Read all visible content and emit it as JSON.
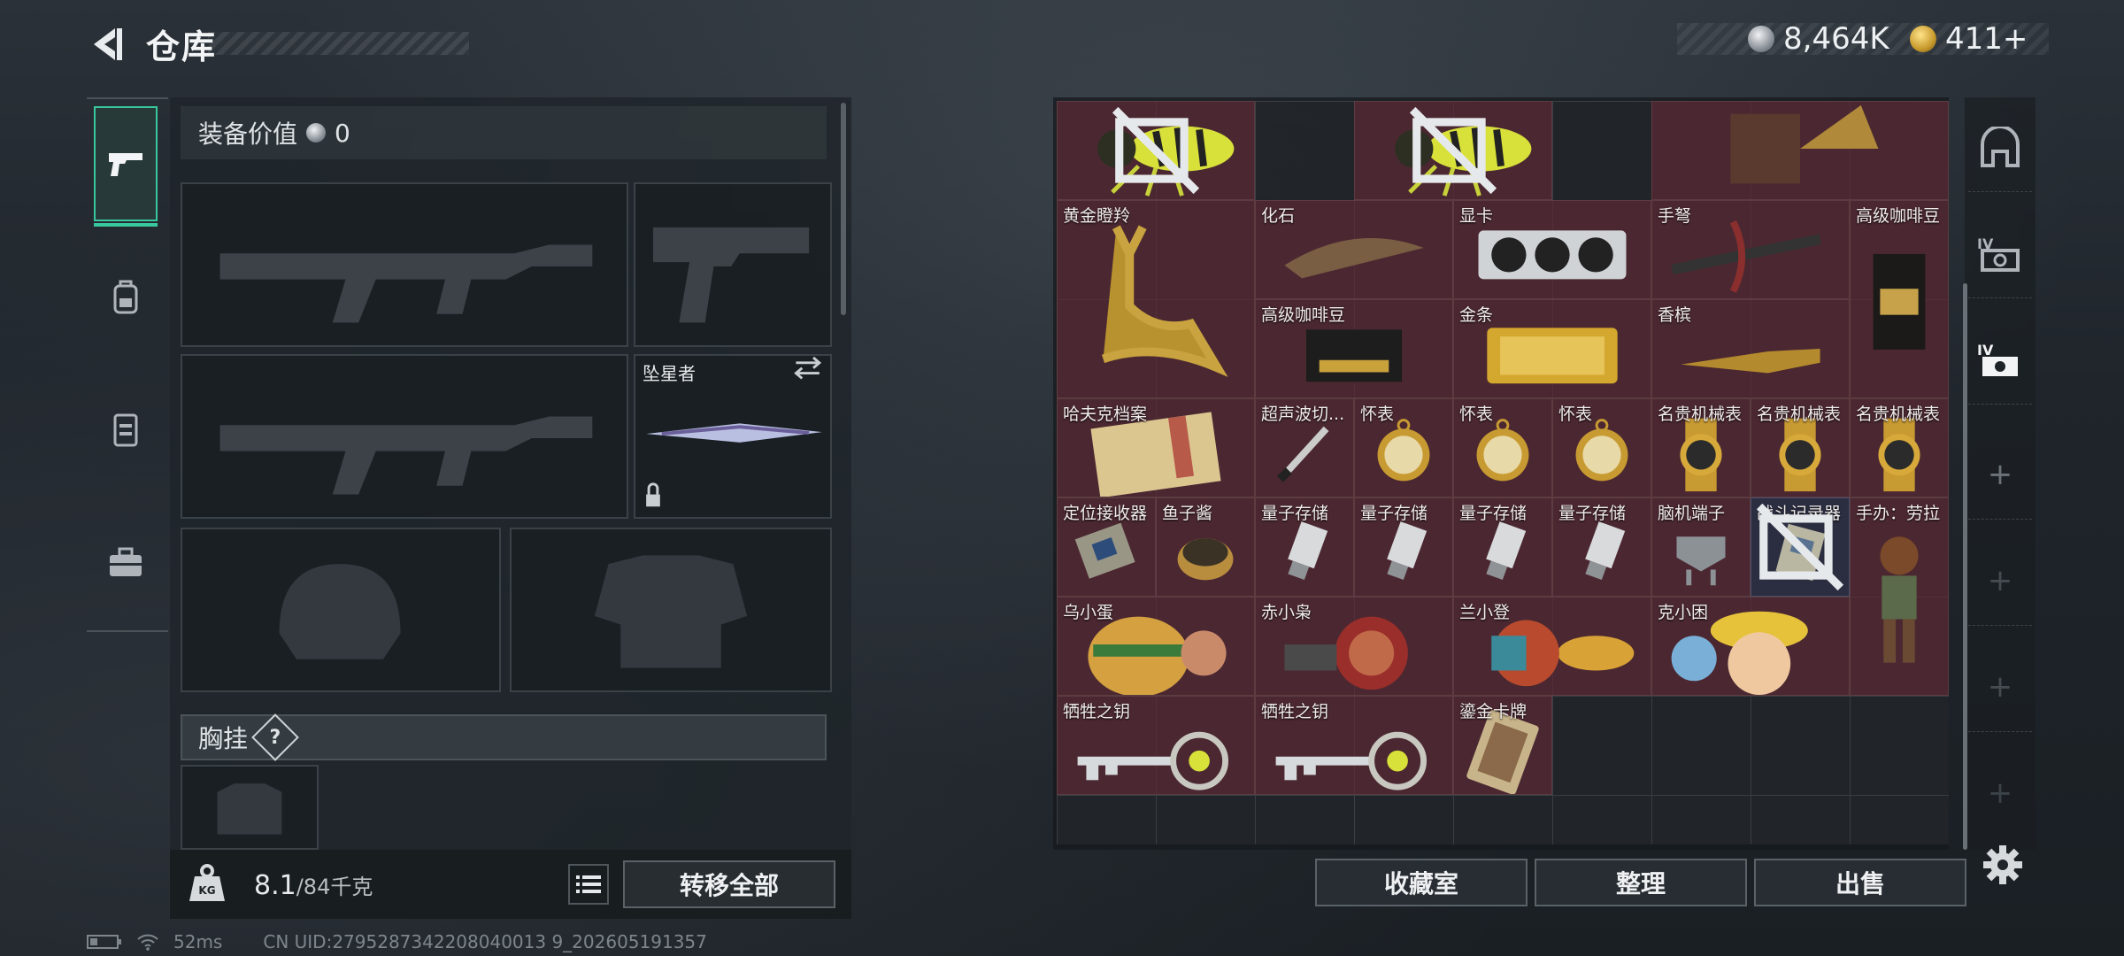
{
  "header": {
    "title": "仓库",
    "currency_silver": "8,464K",
    "currency_gold": "411+"
  },
  "equipment": {
    "value_label": "装备价值",
    "value": "0",
    "melee_name": "坠星者",
    "chest_label": "胸挂",
    "chest_help": "?"
  },
  "weight": {
    "current": "8.1",
    "max": "/84千克"
  },
  "buttons": {
    "transfer_all": "转移全部",
    "collection": "收藏室",
    "organize": "整理",
    "sell": "出售"
  },
  "items": [
    {
      "label": ""
    },
    {
      "label": ""
    },
    {
      "label": ""
    },
    {
      "label": "黄金瞪羚"
    },
    {
      "label": "化石"
    },
    {
      "label": "显卡"
    },
    {
      "label": "手弩"
    },
    {
      "label": "高级咖啡豆"
    },
    {
      "label": "高级咖啡豆"
    },
    {
      "label": "金条"
    },
    {
      "label": "香槟"
    },
    {
      "label": "哈夫克档案"
    },
    {
      "label": "超声波切..."
    },
    {
      "label": "怀表"
    },
    {
      "label": "怀表"
    },
    {
      "label": "怀表"
    },
    {
      "label": "名贵机械表"
    },
    {
      "label": "名贵机械表"
    },
    {
      "label": "名贵机械表"
    },
    {
      "label": "定位接收器"
    },
    {
      "label": "鱼子酱"
    },
    {
      "label": "量子存储"
    },
    {
      "label": "量子存储"
    },
    {
      "label": "量子存储"
    },
    {
      "label": "量子存储"
    },
    {
      "label": "脑机端子"
    },
    {
      "label": "战斗记录器"
    },
    {
      "label": "手办：劳拉"
    },
    {
      "label": "乌小蛋"
    },
    {
      "label": "赤小枭"
    },
    {
      "label": "兰小登"
    },
    {
      "label": "克小困"
    },
    {
      "label": "牺牲之钥"
    },
    {
      "label": "牺牲之钥"
    },
    {
      "label": "鎏金卡牌"
    }
  ],
  "status_bar": {
    "ping": "52ms",
    "uid": "CN UID:2795287342208040013 9_202605191357"
  },
  "colors": {
    "accent": "#39c79e",
    "item_bg": "#5c2a34",
    "item_bg_blue": "#2c3044"
  }
}
